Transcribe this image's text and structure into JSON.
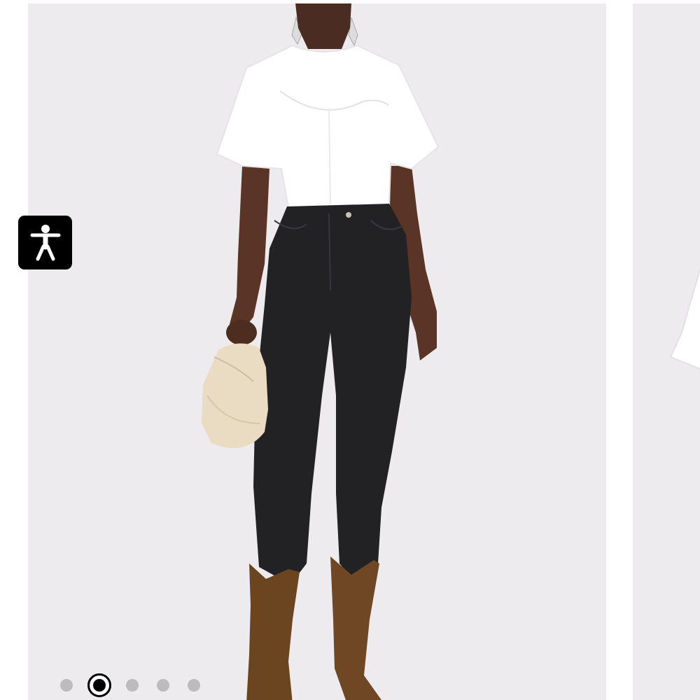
{
  "product_gallery": {
    "images": [
      {
        "alt": "product-photo-model-white-tee-black-jeans"
      },
      {
        "alt": "product-photo-next"
      }
    ],
    "active_index": 1,
    "dot_count": 5
  },
  "accessibility": {
    "icon": "accessibility-person-icon",
    "background": "#000000",
    "icon_color": "#ffffff"
  },
  "colors": {
    "slide_background": "#eeebee",
    "dot_inactive": "#bdbbbd",
    "dot_active": "#000000"
  }
}
